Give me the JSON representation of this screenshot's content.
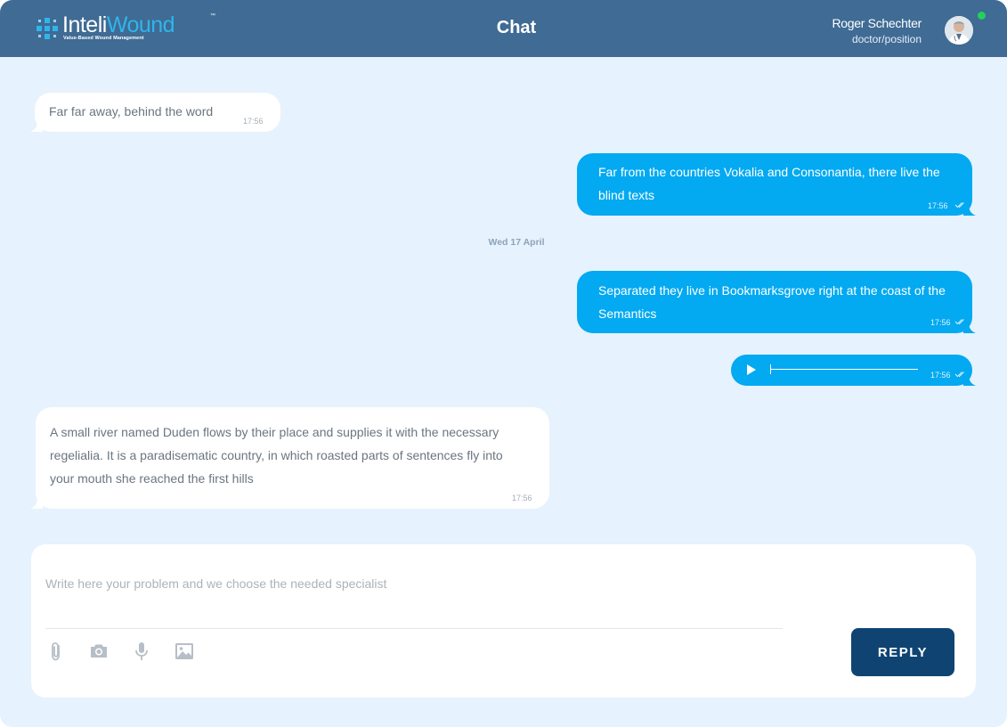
{
  "brand": {
    "name_part1": "Inteli",
    "name_part2": "Wound",
    "trademark": "™",
    "tagline": "Value-Based Wound Management",
    "accent_color": "#2fb5ea"
  },
  "header": {
    "title": "Chat",
    "background_color": "#3f6b94"
  },
  "user": {
    "name": "Roger Schechter",
    "role": "doctor/position",
    "status": "online",
    "status_color": "#22d05a"
  },
  "messages": [
    {
      "direction": "in",
      "text": "Far far away, behind the word",
      "time": "17:56"
    },
    {
      "direction": "out",
      "text": "Far from the countries Vokalia and Consonantia, there live the blind texts",
      "time": "17:56",
      "read": true
    },
    {
      "direction": "out",
      "text": "Separated they live in Bookmarksgrove right at the coast of the Semantics",
      "time": "17:56",
      "read": true
    },
    {
      "direction": "out",
      "type": "audio",
      "time": "17:56",
      "read": true,
      "progress": 0
    },
    {
      "direction": "in",
      "text": "A small river named Duden flows by their place and supplies it with the necessary regelialia. It is a paradisematic country, in which roasted parts of sentences fly into your mouth she reached the first hills",
      "time": "17:56"
    }
  ],
  "date_separator": "Wed 17 April",
  "composer": {
    "placeholder": "Write here your problem and we choose the needed specialist",
    "value": "",
    "tools": [
      "attachment-icon",
      "camera-icon",
      "microphone-icon",
      "image-icon"
    ],
    "reply_label": "REPLY"
  },
  "colors": {
    "outgoing_bubble": "#03a9f1",
    "incoming_bubble": "#ffffff",
    "chat_background": "#e6f2fd",
    "reply_button": "#0f4472"
  }
}
